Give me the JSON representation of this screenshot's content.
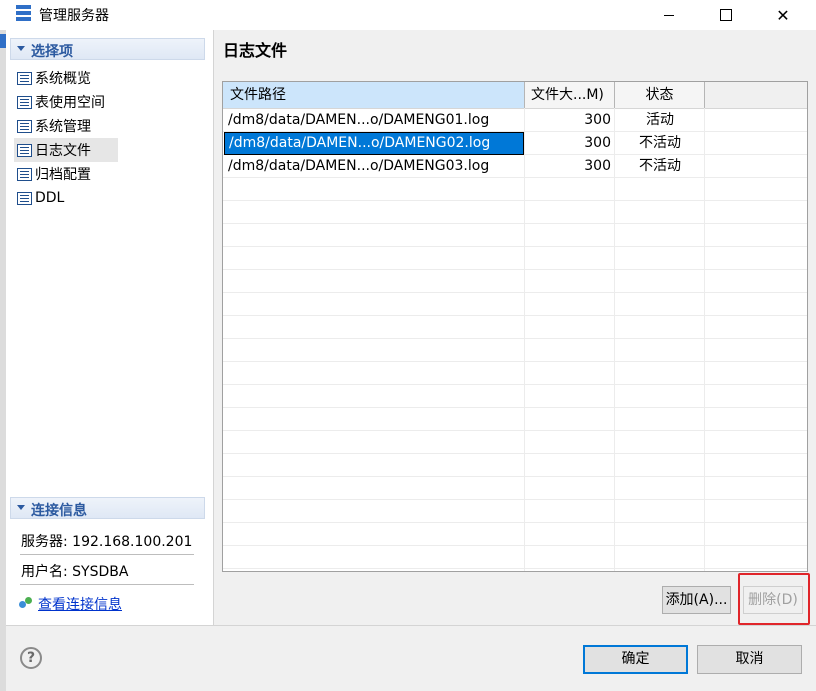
{
  "window": {
    "title": "管理服务器",
    "minimize_icon": "minimize-icon",
    "maximize_icon": "maximize-icon",
    "close_label": "✕"
  },
  "left_panel": {
    "section_options": "选择项",
    "nav_items": [
      {
        "label": "系统概览",
        "icon": "list-icon"
      },
      {
        "label": "表使用空间",
        "icon": "list-icon"
      },
      {
        "label": "系统管理",
        "icon": "list-icon"
      },
      {
        "label": "日志文件",
        "icon": "list-icon",
        "selected": true
      },
      {
        "label": "归档配置",
        "icon": "list-icon"
      },
      {
        "label": "DDL",
        "icon": "list-icon"
      }
    ],
    "section_connection": "连接信息",
    "server_label": "服务器: 192.168.100.201",
    "user_label": "用户名: SYSDBA",
    "view_connection_link": "查看连接信息"
  },
  "main": {
    "title": "日志文件",
    "table": {
      "columns": [
        "文件路径",
        "文件大...M)",
        "状态"
      ],
      "rows": [
        {
          "path": "/dm8/data/DAMEN...o/DAMENG01.log",
          "size": "300",
          "status": "活动"
        },
        {
          "path": "/dm8/data/DAMEN...o/DAMENG02.log",
          "size": "300",
          "status": "不活动",
          "selected": true
        },
        {
          "path": "/dm8/data/DAMEN...o/DAMENG03.log",
          "size": "300",
          "status": "不活动"
        }
      ]
    },
    "add_button": "添加(A)...",
    "delete_button": "删除(D)"
  },
  "footer": {
    "help_icon": "?",
    "ok_button": "确定",
    "cancel_button": "取消"
  },
  "colors": {
    "selection": "#0078d7",
    "highlight_border": "#e0252a",
    "section_title": "#2c5aa0"
  }
}
